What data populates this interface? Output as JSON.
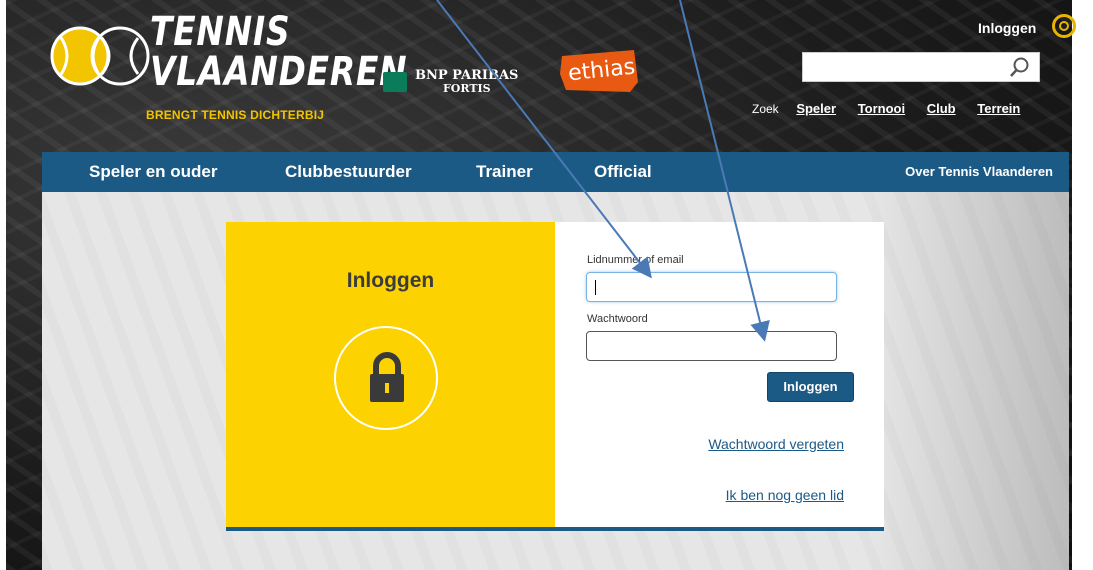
{
  "header": {
    "logo_line1": "TENNIS",
    "logo_line2": "VLAANDEREN",
    "tagline": "BRENGT TENNIS DICHTERBIJ",
    "sponsor1_line1": "BNP PARIBAS",
    "sponsor1_line2": "FORTIS",
    "sponsor2": "ethias",
    "login_label": "Inloggen"
  },
  "search": {
    "value": "",
    "label": "Zoek",
    "links": [
      "Speler",
      "Tornooi",
      "Club",
      "Terrein"
    ]
  },
  "nav": {
    "items": [
      "Speler en ouder",
      "Clubbestuurder",
      "Trainer",
      "Official"
    ],
    "about": "Over Tennis Vlaanderen"
  },
  "login_panel": {
    "title": "Inloggen",
    "username_label": "Lidnummer of email",
    "username_value": "",
    "password_label": "Wachtwoord",
    "password_value": "",
    "submit": "Inloggen",
    "forgot_link": "Wachtwoord vergeten",
    "register_link": "Ik ben nog geen lid"
  },
  "colors": {
    "nav_blue": "#1c5a86",
    "brand_yellow": "#fcd200",
    "tagline_gold": "#f3c400",
    "ethias_orange": "#e85a12",
    "bnp_green": "#0a7c5a",
    "annotation_arrow": "#4a7ab5"
  }
}
